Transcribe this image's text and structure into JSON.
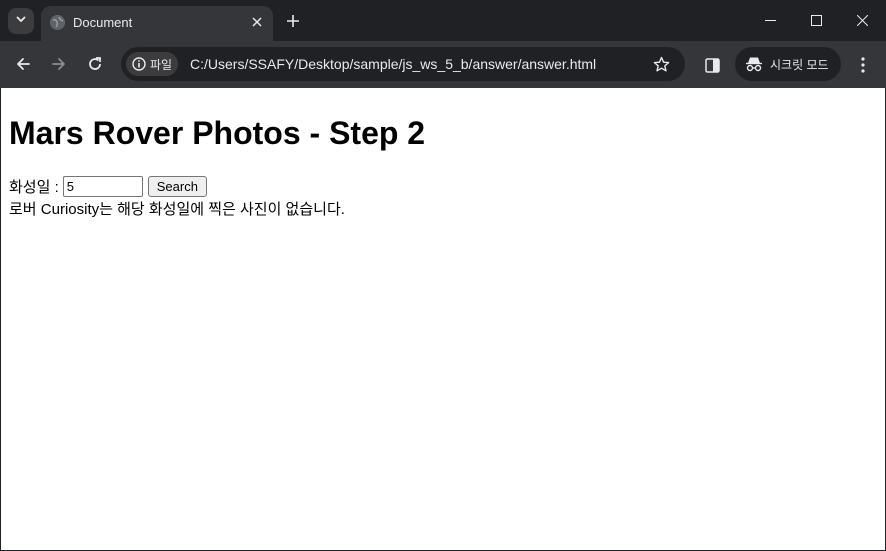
{
  "tab": {
    "title": "Document"
  },
  "omnibox": {
    "chip_label": "파일",
    "url": "C:/Users/SSAFY/Desktop/sample/js_ws_5_b/answer/answer.html"
  },
  "incognito": {
    "label": "시크릿 모드"
  },
  "page": {
    "title": "Mars Rover Photos - Step 2",
    "sol_label": "화성일 : ",
    "sol_value": "5",
    "search_label": "Search",
    "result_text": "로버 Curiosity는 해당 화성일에 찍은 사진이 없습니다."
  },
  "colors": {
    "frame": "#202124",
    "toolbar": "#35363a",
    "tab_active": "#35363a",
    "page_bg": "#ffffff"
  },
  "icons": [
    "tab-search-icon",
    "globe-icon",
    "close-icon",
    "plus-icon",
    "minimize-icon",
    "maximize-icon",
    "window-close-icon",
    "back-icon",
    "forward-icon",
    "reload-icon",
    "info-icon",
    "star-icon",
    "side-panel-icon",
    "incognito-icon",
    "more-vert-icon"
  ]
}
